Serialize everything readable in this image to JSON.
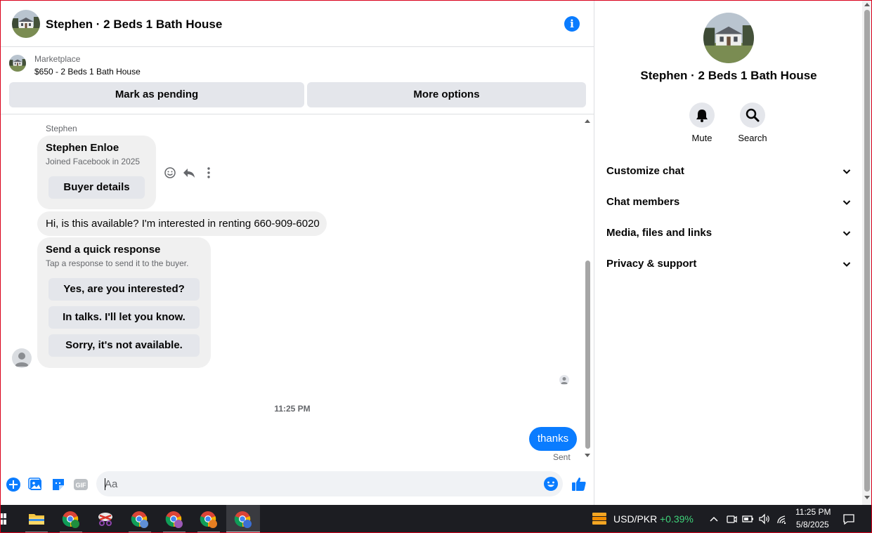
{
  "chat": {
    "title": "Stephen · 2 Beds 1 Bath House",
    "marketplace": {
      "label": "Marketplace",
      "listing": "$650 - 2 Beds 1 Bath House",
      "mark_pending_label": "Mark as pending",
      "more_options_label": "More options"
    },
    "messages": {
      "sender_name": "Stephen",
      "profile_card": {
        "name": "Stephen Enloe",
        "joined": "Joined Facebook in 2025",
        "buyer_details_label": "Buyer details"
      },
      "first_message": "Hi, is this available? I'm interested in renting 660-909-6020",
      "quick_response": {
        "title": "Send a quick response",
        "subtitle": "Tap a response to send it to the buyer.",
        "options": [
          "Yes, are you interested?",
          "In talks. I'll let you know.",
          "Sorry, it's not available."
        ]
      },
      "timestamp": "11:25 PM",
      "outgoing": "thanks",
      "status": "Sent"
    },
    "composer": {
      "placeholder": "Aa"
    }
  },
  "info_panel": {
    "title": "Stephen · 2 Beds 1 Bath House",
    "actions": [
      {
        "label": "Mute",
        "icon": "bell-icon"
      },
      {
        "label": "Search",
        "icon": "search-icon"
      }
    ],
    "sections": [
      "Customize chat",
      "Chat members",
      "Media, files and links",
      "Privacy & support"
    ]
  },
  "taskbar": {
    "ticker_symbol": "USD/PKR",
    "ticker_change": "+0.39%",
    "time": "11:25 PM",
    "date": "5/8/2025"
  },
  "colors": {
    "accent": "#0a7cff",
    "bubble_gray": "#f0f0f0",
    "button_gray": "#e4e6eb",
    "taskbar": "#1c1d22",
    "ticker_up": "#3fd37a"
  }
}
